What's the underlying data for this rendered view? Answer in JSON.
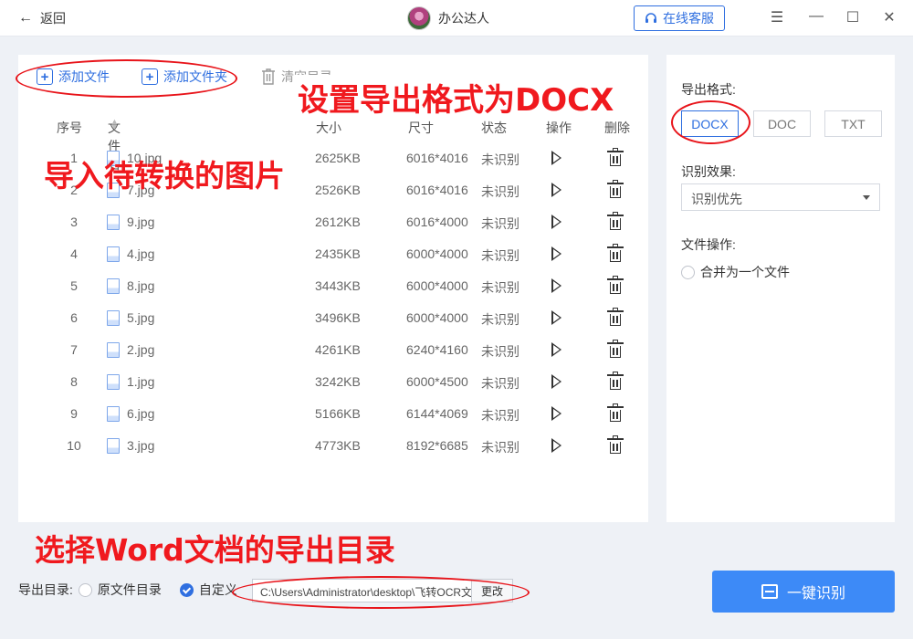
{
  "titlebar": {
    "back_label": "返回",
    "username": "办公达人",
    "service_label": "在线客服"
  },
  "toolbar": {
    "add_file": "添加文件",
    "add_folder": "添加文件夹",
    "clear_list": "清空目录"
  },
  "table": {
    "headers": [
      "序号",
      "文件名",
      "大小",
      "尺寸",
      "状态",
      "操作",
      "删除"
    ],
    "rows": [
      {
        "no": "1",
        "name": "10.jpg",
        "size": "2625KB",
        "dim": "6016*4016",
        "status": "未识别"
      },
      {
        "no": "2",
        "name": "7.jpg",
        "size": "2526KB",
        "dim": "6016*4016",
        "status": "未识别"
      },
      {
        "no": "3",
        "name": "9.jpg",
        "size": "2612KB",
        "dim": "6016*4000",
        "status": "未识别"
      },
      {
        "no": "4",
        "name": "4.jpg",
        "size": "2435KB",
        "dim": "6000*4000",
        "status": "未识别"
      },
      {
        "no": "5",
        "name": "8.jpg",
        "size": "3443KB",
        "dim": "6000*4000",
        "status": "未识别"
      },
      {
        "no": "6",
        "name": "5.jpg",
        "size": "3496KB",
        "dim": "6000*4000",
        "status": "未识别"
      },
      {
        "no": "7",
        "name": "2.jpg",
        "size": "4261KB",
        "dim": "6240*4160",
        "status": "未识别"
      },
      {
        "no": "8",
        "name": "1.jpg",
        "size": "3242KB",
        "dim": "6000*4500",
        "status": "未识别"
      },
      {
        "no": "9",
        "name": "6.jpg",
        "size": "5166KB",
        "dim": "6144*4069",
        "status": "未识别"
      },
      {
        "no": "10",
        "name": "3.jpg",
        "size": "4773KB",
        "dim": "8192*6685",
        "status": "未识别"
      }
    ]
  },
  "settings": {
    "export_format_label": "导出格式:",
    "formats": [
      "DOCX",
      "DOC",
      "TXT"
    ],
    "selected_format": "DOCX",
    "recognition_label": "识别效果:",
    "recognition_value": "识别优先",
    "file_op_label": "文件操作:",
    "merge_label": "合并为一个文件"
  },
  "bottom": {
    "output_dir_label": "导出目录:",
    "original_dir_label": "原文件目录",
    "custom_label": "自定义",
    "path_value": "C:\\Users\\Administrator\\desktop\\飞转OCR文",
    "change_label": "更改",
    "ocr_button": "一键识别"
  },
  "annotations": {
    "set_format": "设置导出格式为DOCX",
    "import_images": "导入待转换的图片",
    "choose_dir": "选择Word文档的导出目录"
  },
  "colors": {
    "accent": "#2f6fe0",
    "primary_button": "#3d8af7",
    "annotation_red": "#f0191e"
  }
}
